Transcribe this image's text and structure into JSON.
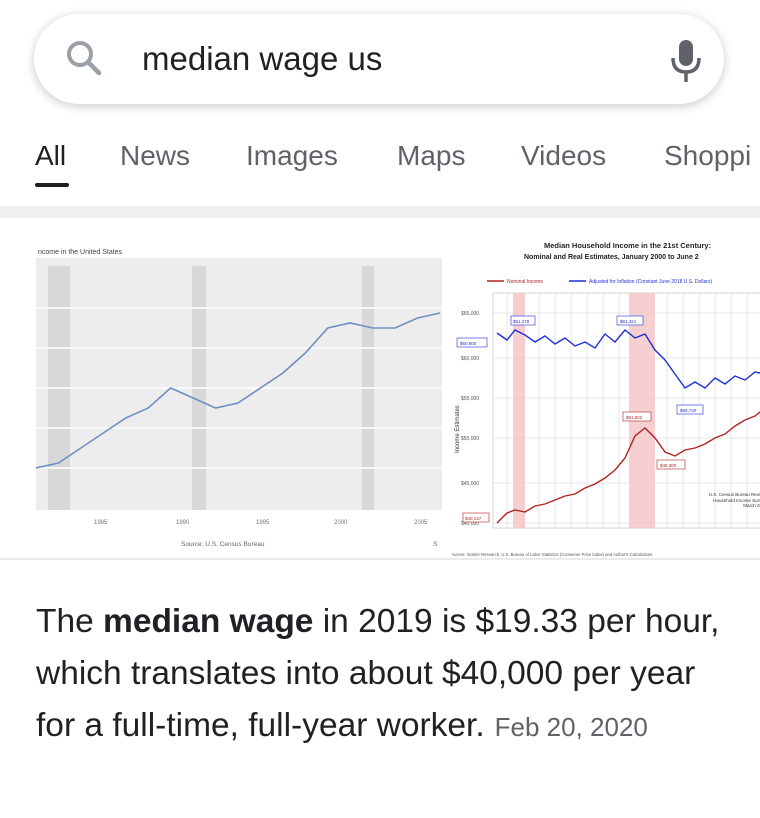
{
  "search": {
    "query": "median wage us",
    "icon_left": "search-icon",
    "icon_right": "microphone-icon"
  },
  "tabs": [
    {
      "label": "All",
      "active": true
    },
    {
      "label": "News"
    },
    {
      "label": "Images"
    },
    {
      "label": "Maps"
    },
    {
      "label": "Videos"
    },
    {
      "label": "Shoppi"
    }
  ],
  "images": {
    "image1": {
      "title_partial": "ncome in the United States",
      "source": "Source: U.S. Census Bureau",
      "x_ticks": [
        "1985",
        "1990",
        "1995",
        "2000",
        "2005"
      ],
      "trend": [
        34,
        35,
        38,
        41,
        44,
        46,
        50,
        48,
        46,
        47,
        50,
        53,
        57,
        62,
        63,
        62,
        62,
        64,
        65
      ]
    },
    "image2": {
      "title_line1": "Median Household Income in the 21st Century:",
      "title_line2": "Nominal and Real Estimates, January 2000 to June 2",
      "legend_nominal": "Nominal Income",
      "legend_real": "Adjusted for Inflation (Constant June 2018 U.S. Dollars)",
      "y_axis_label": "Income Estimates",
      "y_ticks": [
        "$65,000",
        "$60,000",
        "$55,000",
        "$50,000",
        "$45,000",
        "$40,000"
      ],
      "callouts": [
        "$61,270",
        "$61,421",
        "$60,600",
        "$56,720",
        "$51,822",
        "$48,300",
        "$40,147"
      ],
      "note": "U.S. Census Bureau Review: Household Income Survey, March 2018",
      "source": "Sources: Sentier Research, U.S. Bureau of Labor Statistics (Consumer Price Index) and Author's Calculations",
      "colors": {
        "nominal": "#b22222",
        "real": "#1f2fd6",
        "recession": "#f4c4c4"
      }
    },
    "image3_partial_label": "S"
  },
  "answer": {
    "text_before": "The ",
    "bold": "median wage",
    "text_after": " in 2019 is $19.33 per hour, which translates into about $40,000 per year for a full-time, full-year worker.",
    "date": "Feb 20, 2020"
  }
}
